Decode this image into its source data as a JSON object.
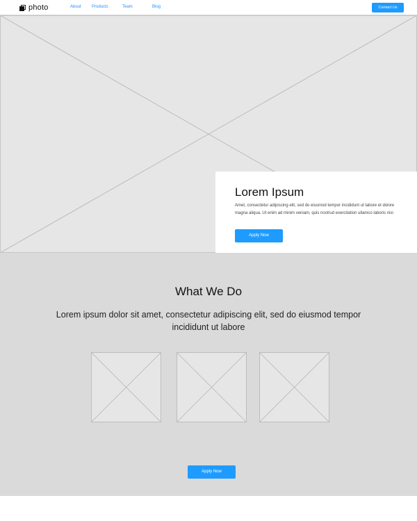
{
  "header": {
    "logo_text": "photo",
    "logo_icon": "photo-logo-icon",
    "nav": [
      {
        "label": "About"
      },
      {
        "label": "Products"
      },
      {
        "label": "Team"
      },
      {
        "label": "Blog"
      }
    ],
    "contact_label": "Contact Us"
  },
  "hero": {
    "image_icon": "image-placeholder-icon",
    "title": "Lorem Ipsum",
    "body": "Amet, consectetur adipiscing elit, sed do eiusmod tempor incididunt ut labore et dolore magna aliqua. Ut enim ad minim veniam, quis nostrud exercitation ullamco laboris nisi",
    "button_label": "Apply Now"
  },
  "what_we_do": {
    "title": "What We Do",
    "lead": "Lorem ipsum dolor sit amet, consectetur adipiscing elit, sed do eiusmod tempor incididunt ut labore",
    "thumbnails_icon": "image-placeholder-icon",
    "button_label": "Apply Now"
  },
  "colors": {
    "accent": "#1e9bff",
    "link": "#1e90ff",
    "placeholder_bg": "#e6e6e6",
    "section_bg": "#dadada"
  }
}
